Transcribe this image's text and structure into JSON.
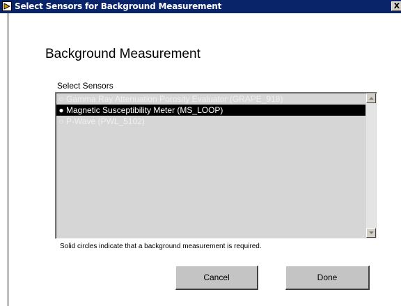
{
  "window": {
    "title": "Select Sensors for Background Measurement",
    "close_label": "X"
  },
  "heading": "Background Measurement",
  "sensor_list": {
    "label": "Select Sensors",
    "items": [
      {
        "bullet": "○",
        "text": "Gamma Ray Attenuation Porosity Evaluator  (GRAPE_918)",
        "state": "disabled"
      },
      {
        "bullet": "●",
        "text": "Magnetic Susceptibility Meter  (MS_LOOP)",
        "state": "selected"
      },
      {
        "bullet": "○",
        "text": "P-Wave  (PWL_5102)",
        "state": "disabled"
      }
    ]
  },
  "note": "Solid circles indicate that a background measurement is required.",
  "buttons": {
    "cancel": "Cancel",
    "done": "Done"
  },
  "colors": {
    "titlebar": "#0a246a",
    "list_background": "#d6d6d6",
    "selection": "#000000",
    "button_face": "#c4c4c4"
  }
}
